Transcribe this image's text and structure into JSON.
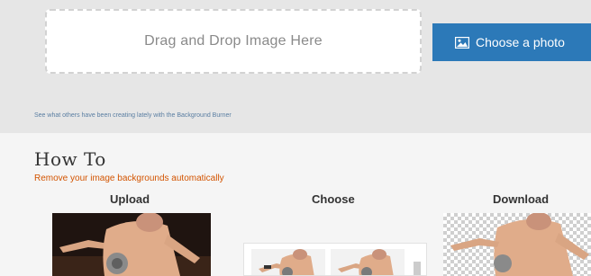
{
  "upload_area": {
    "dropzone_text": "Drag and Drop Image Here",
    "choose_button_label": "Choose a photo",
    "button_icon": "image-icon",
    "see_others_text": "See what others have been creating lately with the Background Burner"
  },
  "howto": {
    "title": "How To",
    "subtitle": "Remove your image backgrounds automatically",
    "columns": [
      {
        "heading": "Upload"
      },
      {
        "heading": "Choose"
      },
      {
        "heading": "Download"
      }
    ]
  },
  "colors": {
    "accent": "#2c79b8",
    "subtitle": "#d35400"
  }
}
